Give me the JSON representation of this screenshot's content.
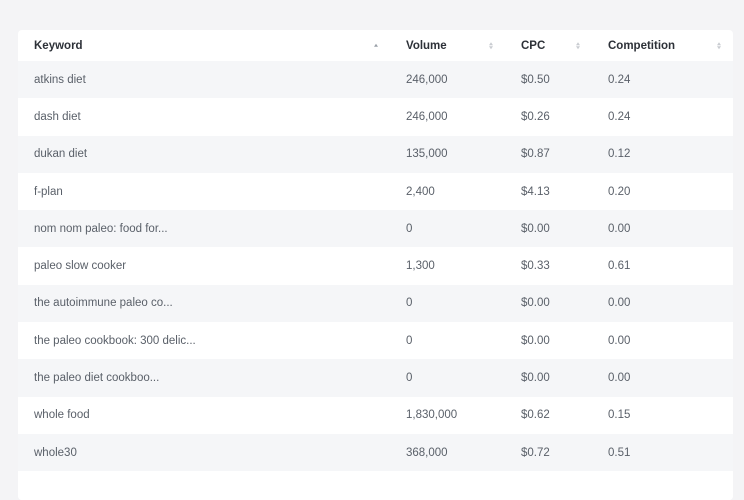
{
  "table": {
    "headers": {
      "keyword": "Keyword",
      "volume": "Volume",
      "cpc": "CPC",
      "competition": "Competition"
    },
    "rows": [
      {
        "keyword": "atkins diet",
        "volume": "246,000",
        "cpc": "$0.50",
        "competition": "0.24"
      },
      {
        "keyword": "dash diet",
        "volume": "246,000",
        "cpc": "$0.26",
        "competition": "0.24"
      },
      {
        "keyword": "dukan diet",
        "volume": "135,000",
        "cpc": "$0.87",
        "competition": "0.12"
      },
      {
        "keyword": "f-plan",
        "volume": "2,400",
        "cpc": "$4.13",
        "competition": "0.20"
      },
      {
        "keyword": "nom nom paleo: food for...",
        "volume": "0",
        "cpc": "$0.00",
        "competition": "0.00"
      },
      {
        "keyword": "paleo slow cooker",
        "volume": "1,300",
        "cpc": "$0.33",
        "competition": "0.61"
      },
      {
        "keyword": "the autoimmune paleo co...",
        "volume": "0",
        "cpc": "$0.00",
        "competition": "0.00"
      },
      {
        "keyword": "the paleo cookbook: 300 delic...",
        "volume": "0",
        "cpc": "$0.00",
        "competition": "0.00"
      },
      {
        "keyword": "the paleo diet cookboo...",
        "volume": "0",
        "cpc": "$0.00",
        "competition": "0.00"
      },
      {
        "keyword": "whole food",
        "volume": "1,830,000",
        "cpc": "$0.62",
        "competition": "0.15"
      },
      {
        "keyword": "whole30",
        "volume": "368,000",
        "cpc": "$0.72",
        "competition": "0.51"
      }
    ],
    "sort": {
      "column": "keyword",
      "direction": "ascending"
    }
  },
  "icons": {
    "sort_active": "sort-ascending-icon",
    "sort_inactive": "sort-both-icon"
  },
  "colors": {
    "header_text": "#2d3138",
    "cell_text": "#5a6069",
    "stripe": "#f5f6f8",
    "background": "#f4f4f6"
  }
}
